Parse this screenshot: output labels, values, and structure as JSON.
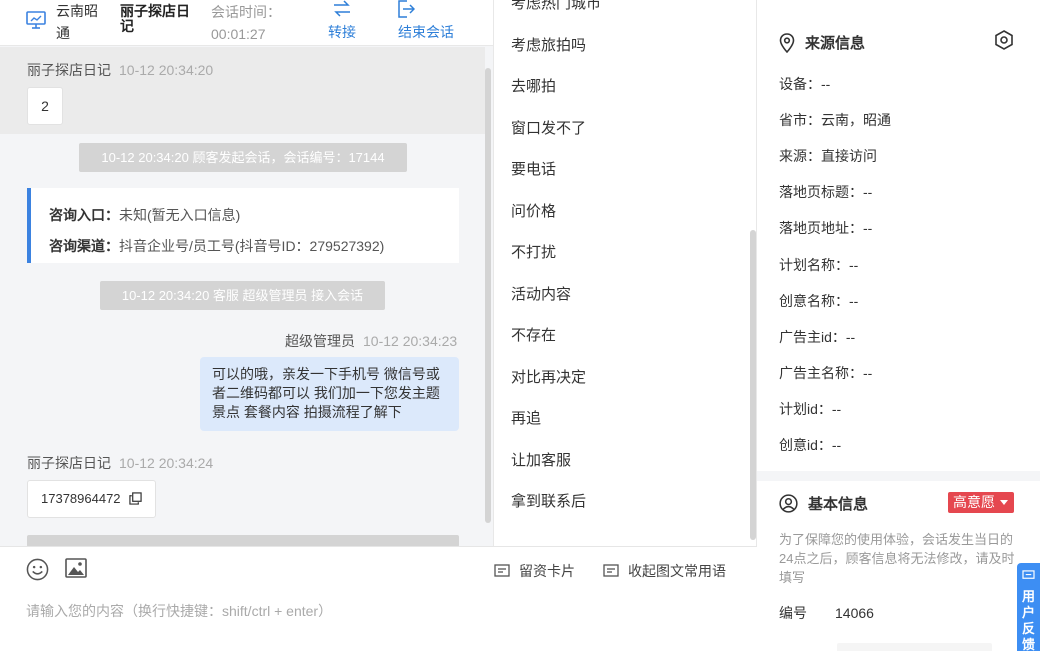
{
  "header": {
    "location": "云南昭通",
    "customer_name": "丽子探店日记",
    "session_time_label": "会话时间：",
    "session_time": "00:01:27",
    "transfer_label": "转接",
    "end_session_label": "结束会话"
  },
  "messages": {
    "m1": {
      "sender": "丽子探店日记",
      "time": "10-12 20:34:20",
      "text": "2"
    },
    "sys1": "10-12 20:34:20 顾客发起会话，会话编号：17144",
    "consult": {
      "entry_label": "咨询入口：",
      "entry_value": "未知(暂无入口信息)",
      "channel_label": "咨询渠道：",
      "channel_value": "抖音企业号/员工号(抖音号ID：279527392)"
    },
    "sys2": "10-12 20:34:20 客服 超级管理员 接入会话",
    "m2": {
      "sender": "超级管理员",
      "time": "10-12 20:34:23",
      "text": "可以的哦，亲发一下手机号 微信号或者二维码都可以 我们加一下您发主题景点 套餐内容 拍摄流程了解下"
    },
    "m3": {
      "sender": "丽子探店日记",
      "time": "10-12 20:34:24",
      "text": "17378964472"
    }
  },
  "composer": {
    "card_label": "留资卡片",
    "phrases_label": "收起图文常用语",
    "placeholder": "请输入您的内容（换行快捷键：shift/ctrl + enter）"
  },
  "quick_replies": [
    "考虑热门城市",
    "考虑旅拍吗",
    "去哪拍",
    "窗口发不了",
    "要电话",
    "问价格",
    "不打扰",
    "活动内容",
    "不存在",
    "对比再决定",
    "再追",
    "让加客服",
    "拿到联系后"
  ],
  "source_info": {
    "title": "来源信息",
    "rows": [
      "设备：--",
      "省市：云南，昭通",
      "来源：直接访问",
      "落地页标题：--",
      "落地页地址：--",
      "计划名称：--",
      "创意名称：--",
      "广告主id：--",
      "广告主名称：--",
      "计划id：--",
      "创意id：--"
    ]
  },
  "basic_info": {
    "title": "基本信息",
    "intent": "高意愿",
    "note": "为了保障您的使用体验，会话发生当日的24点之后，顾客信息将无法修改，请及时填写",
    "id_label": "编号",
    "id_value": "14066"
  },
  "feedback_label": "用户反馈",
  "colors": {
    "accent": "#2e7fd8",
    "agent_bubble": "#dce9fb",
    "system_notice": "#d4d4d4",
    "intent_badge": "#e5474f",
    "feedback_tab": "#3d8ef3"
  }
}
